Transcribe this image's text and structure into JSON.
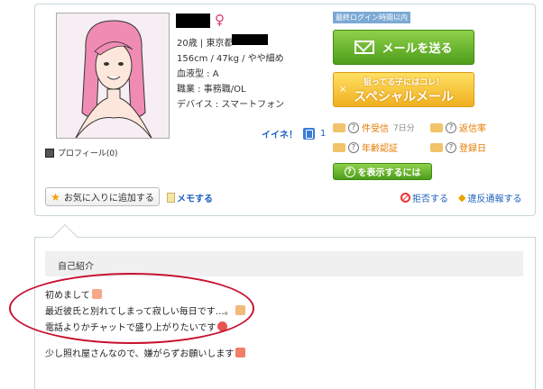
{
  "profile": {
    "age_location": "20歳 | 東京都",
    "body": "156cm / 47kg / やや細め",
    "blood": "血液型 : A",
    "job": "職業 : 事務職/OL",
    "device": "デバイス : スマートフォン",
    "gender_symbol": "♀",
    "profile_link": "プロフィール(0)"
  },
  "like": {
    "label": "イイネ！",
    "count": "1"
  },
  "login_badge": "最終ログイン時間以内",
  "mail_button": "メールを送る",
  "special": {
    "sub": "狙ってる子にはコレ！",
    "main": "スペシャルメール",
    "x": "×"
  },
  "stats": {
    "received": {
      "q": "?",
      "label": "件受信",
      "value": "7日分"
    },
    "reply_rate": {
      "q": "?",
      "label": "返信率"
    },
    "age_verify": {
      "q": "?",
      "label": "年齢認証"
    },
    "registered": {
      "q": "?",
      "label": "登録日"
    }
  },
  "show_button": {
    "q": "?",
    "label": "を表示するには"
  },
  "actions": {
    "favorite": "お気に入りに追加する",
    "memo": "メモする",
    "block": "拒否する",
    "report": "違反通報する"
  },
  "intro": {
    "header": "自己紹介",
    "lines": [
      "初めまして",
      "最近彼氏と別れてしまって寂しい毎日です…。",
      "電話よりかチャットで盛り上がりたいです",
      "少し照れ屋さんなので、嫌がらずお願いします"
    ]
  },
  "colors": {
    "accent_green": "#5aa821",
    "accent_orange": "#f0b020",
    "link_blue": "#1d5fbf",
    "annotation_red": "#c8102e"
  }
}
